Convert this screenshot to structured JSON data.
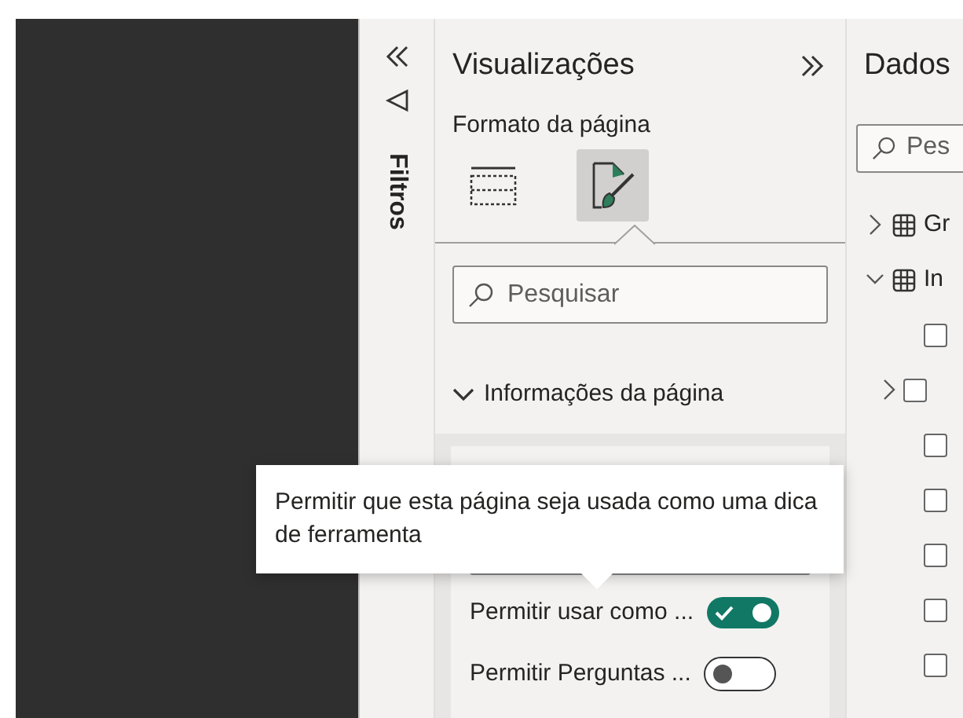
{
  "filters_pane": {
    "label": "Filtros"
  },
  "visualizations_pane": {
    "title": "Visualizações",
    "subtitle": "Formato da página",
    "format_tabs": [
      {
        "kind": "fields",
        "selected": false
      },
      {
        "kind": "format",
        "selected": true
      }
    ],
    "search": {
      "placeholder": "Pesquisar"
    },
    "section": {
      "title": "Informações da página",
      "expanded": true
    },
    "toggles": [
      {
        "label": "Permitir usar como ...",
        "on": true
      },
      {
        "label": "Permitir Perguntas ...",
        "on": false
      }
    ]
  },
  "data_pane": {
    "title": "Dados",
    "search": {
      "placeholder": "Pes"
    },
    "tables": [
      {
        "name": "Gr",
        "expanded": false
      },
      {
        "name": "In",
        "expanded": true,
        "fields": [
          {
            "expandable": false,
            "checked": false
          },
          {
            "expandable": true,
            "checked": false
          },
          {
            "expandable": false,
            "checked": false
          },
          {
            "expandable": false,
            "checked": false
          },
          {
            "expandable": false,
            "checked": false
          },
          {
            "expandable": false,
            "checked": false
          },
          {
            "expandable": false,
            "checked": false
          }
        ]
      }
    ]
  },
  "tooltip": {
    "text": "Permitir que esta página seja usada como uma dica de ferramenta"
  }
}
